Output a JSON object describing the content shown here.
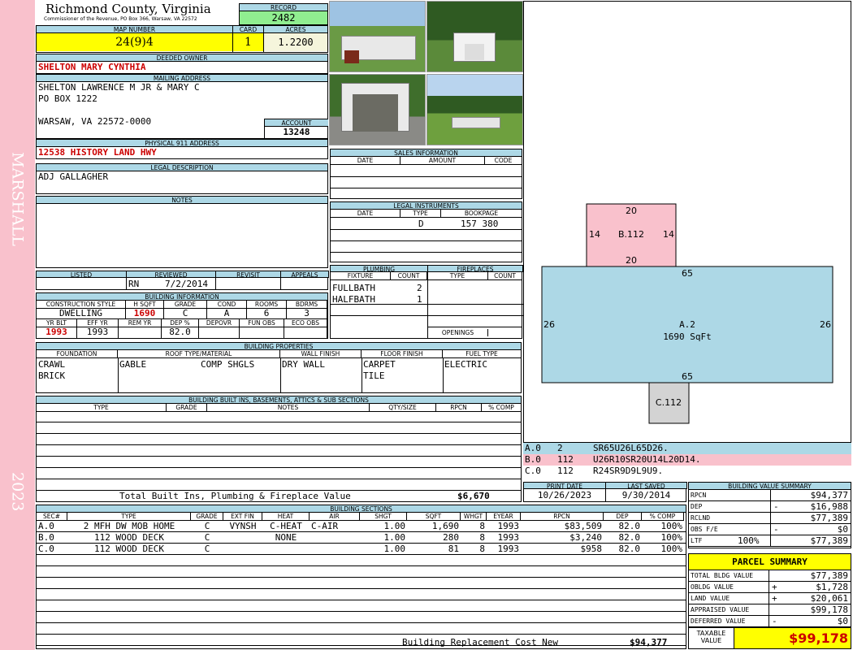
{
  "side": {
    "district": "MARSHALL",
    "year": "2023"
  },
  "header": {
    "county": "Richmond County, Virginia",
    "commissioner": "Commissioner of the Revenue, PO Box 366, Warsaw, VA 22572",
    "record_label": "RECORD",
    "record": "2482",
    "map_label": "MAP NUMBER",
    "map": "24(9)4",
    "card_label": "CARD",
    "card": "1",
    "acres_label": "ACRES",
    "acres": "1.2200"
  },
  "owner": {
    "label": "DEEDED OWNER",
    "name": "SHELTON MARY CYNTHIA"
  },
  "mailing": {
    "label": "MAILING ADDRESS",
    "line1": "SHELTON LAWRENCE M JR & MARY C",
    "line2": "PO BOX 1222",
    "line3": "WARSAW, VA 22572-0000",
    "account_label": "ACCOUNT",
    "account": "13248"
  },
  "physical": {
    "label": "PHYSICAL 911 ADDRESS",
    "address": "12538 HISTORY LAND HWY"
  },
  "legal": {
    "label": "LEGAL DESCRIPTION",
    "text": "ADJ GALLAGHER"
  },
  "notes": {
    "label": "NOTES"
  },
  "listing": {
    "listed": "LISTED",
    "reviewed": "REVIEWED",
    "revisit": "REVISIT",
    "appeals": "APPEALS",
    "reviewer": "RN",
    "review_date": "7/2/2014"
  },
  "building_info": {
    "label": "BUILDING INFORMATION",
    "h1": "CONSTRUCTION STYLE",
    "h2": "H SQFT",
    "h3": "GRADE",
    "h4": "COND",
    "h5": "ROOMS",
    "h6": "BDRMS",
    "style": "DWELLING",
    "sqft": "1690",
    "grade": "C",
    "cond": "A",
    "rooms": "6",
    "bdrms": "3",
    "h7": "YR BLT",
    "h8": "EFF YR",
    "h9": "REM YR",
    "h10": "DEP %",
    "h11": "DEPOVR",
    "h12": "FUN OBS",
    "h13": "ECO OBS",
    "yr_blt": "1993",
    "eff_yr": "1993",
    "dep": "82.0"
  },
  "sales": {
    "label": "SALES INFORMATION",
    "date": "DATE",
    "amount": "AMOUNT",
    "code": "CODE"
  },
  "legal_instr": {
    "label": "LEGAL INSTRUMENTS",
    "date": "DATE",
    "type": "TYPE",
    "bookpage": "BOOKPAGE",
    "r_type": "D",
    "r_book": "157 380"
  },
  "plumbing": {
    "label": "PLUMBING",
    "fixture": "FIXTURE",
    "count": "COUNT",
    "r1": "FULLBATH",
    "c1": "2",
    "r2": "HALFBATH",
    "c2": "1"
  },
  "fireplaces": {
    "label": "FIREPLACES",
    "type": "TYPE",
    "count": "COUNT",
    "openings": "OPENINGS"
  },
  "props": {
    "label": "BUILDING PROPERTIES",
    "foundation": "FOUNDATION",
    "roof": "ROOF TYPE/MATERIAL",
    "wall": "WALL FINISH",
    "floor": "FLOOR FINISH",
    "fuel": "FUEL TYPE",
    "f1": "CRAWL",
    "f2": "BRICK",
    "r1": "GABLE",
    "r2": "COMP SHGLS",
    "w1": "DRY WALL",
    "fl1": "CARPET",
    "fl2": "TILE",
    "fu1": "ELECTRIC"
  },
  "builtins": {
    "label": "BUILDING BUILT INS, BASEMENTS, ATTICS & SUB SECTIONS",
    "type": "TYPE",
    "grade": "GRADE",
    "notes": "NOTES",
    "qty": "QTY/SIZE",
    "rpcn": "RPCN",
    "comp": "% COMP",
    "total_label": "Total Built Ins, Plumbing & Fireplace Value",
    "total": "$6,670"
  },
  "dates": {
    "print_label": "PRINT DATE",
    "saved_label": "LAST SAVED",
    "print": "10/26/2023",
    "saved": "9/30/2014"
  },
  "sections": {
    "label": "BUILDING SECTIONS",
    "headers": [
      "SEC#",
      "TYPE",
      "GRADE",
      "EXT FIN",
      "HEAT",
      "AIR",
      "SHGT",
      "SQFT",
      "WHGT",
      "EYEAR",
      "RPCN",
      "DEP",
      "% COMP"
    ],
    "rows": [
      [
        "A.0",
        "2 MFH DW MOB HOME",
        "C",
        "VYNSH",
        "C-HEAT",
        "C-AIR",
        "1.00",
        "1,690",
        "8",
        "1993",
        "$83,509",
        "82.0",
        "100%"
      ],
      [
        "B.0",
        "112 WOOD DECK",
        "C",
        "",
        "NONE",
        "",
        "1.00",
        "280",
        "8",
        "1993",
        "$3,240",
        "82.0",
        "100%"
      ],
      [
        "C.0",
        "112 WOOD DECK",
        "C",
        "",
        "",
        "",
        "1.00",
        "81",
        "8",
        "1993",
        "$958",
        "82.0",
        "100%"
      ]
    ],
    "total_label": "Building Replacement Cost New",
    "total": "$94,377"
  },
  "sketch": {
    "b_label": "B.112",
    "b_top": "20",
    "b_bottom": "20",
    "b_left": "14",
    "b_right": "14",
    "a_label": "A.2",
    "a_area": "1690 SqFt",
    "a_top": "65",
    "a_bottom": "65",
    "a_left": "26",
    "a_right": "26",
    "c_label": "C.112",
    "colors": {
      "a": "#add8e6",
      "b": "#f9c1cc",
      "c": "#d3d3d3"
    }
  },
  "vectors": [
    {
      "id": "A.0",
      "code": "2",
      "v": "SR65U26L65D26."
    },
    {
      "id": "B.0",
      "code": "112",
      "v": "U26R10SR20U14L20D14."
    },
    {
      "id": "C.0",
      "code": "112",
      "v": "R24SR9D9L9U9."
    }
  ],
  "value_summary": {
    "label": "BUILDING VALUE SUMMARY",
    "rpcn_l": "RPCN",
    "rpcn": "$94,377",
    "dep_l": "DEP",
    "dep_s": "-",
    "dep": "$16,988",
    "rclnd_l": "RCLND",
    "rclnd": "$77,389",
    "obs_l": "OBS F/E",
    "obs_s": "-",
    "obs": "$0",
    "ltr_l": "LTF",
    "ltr_p": "100%",
    "ltr": "$77,389"
  },
  "parcel": {
    "label": "PARCEL SUMMARY",
    "tb_l": "TOTAL BLDG VALUE",
    "tb": "$77,389",
    "ob_l": "OBLDG VALUE",
    "ob_s": "+",
    "ob": "$1,728",
    "lv_l": "LAND VALUE",
    "lv_s": "+",
    "lv": "$20,061",
    "av_l": "APPRAISED VALUE",
    "av": "$99,178",
    "dv_l": "DEFERRED VALUE",
    "dv_s": "-",
    "dv": "$0",
    "tv_l1": "TAXABLE",
    "tv_l2": "VALUE",
    "tv": "$99,178"
  }
}
